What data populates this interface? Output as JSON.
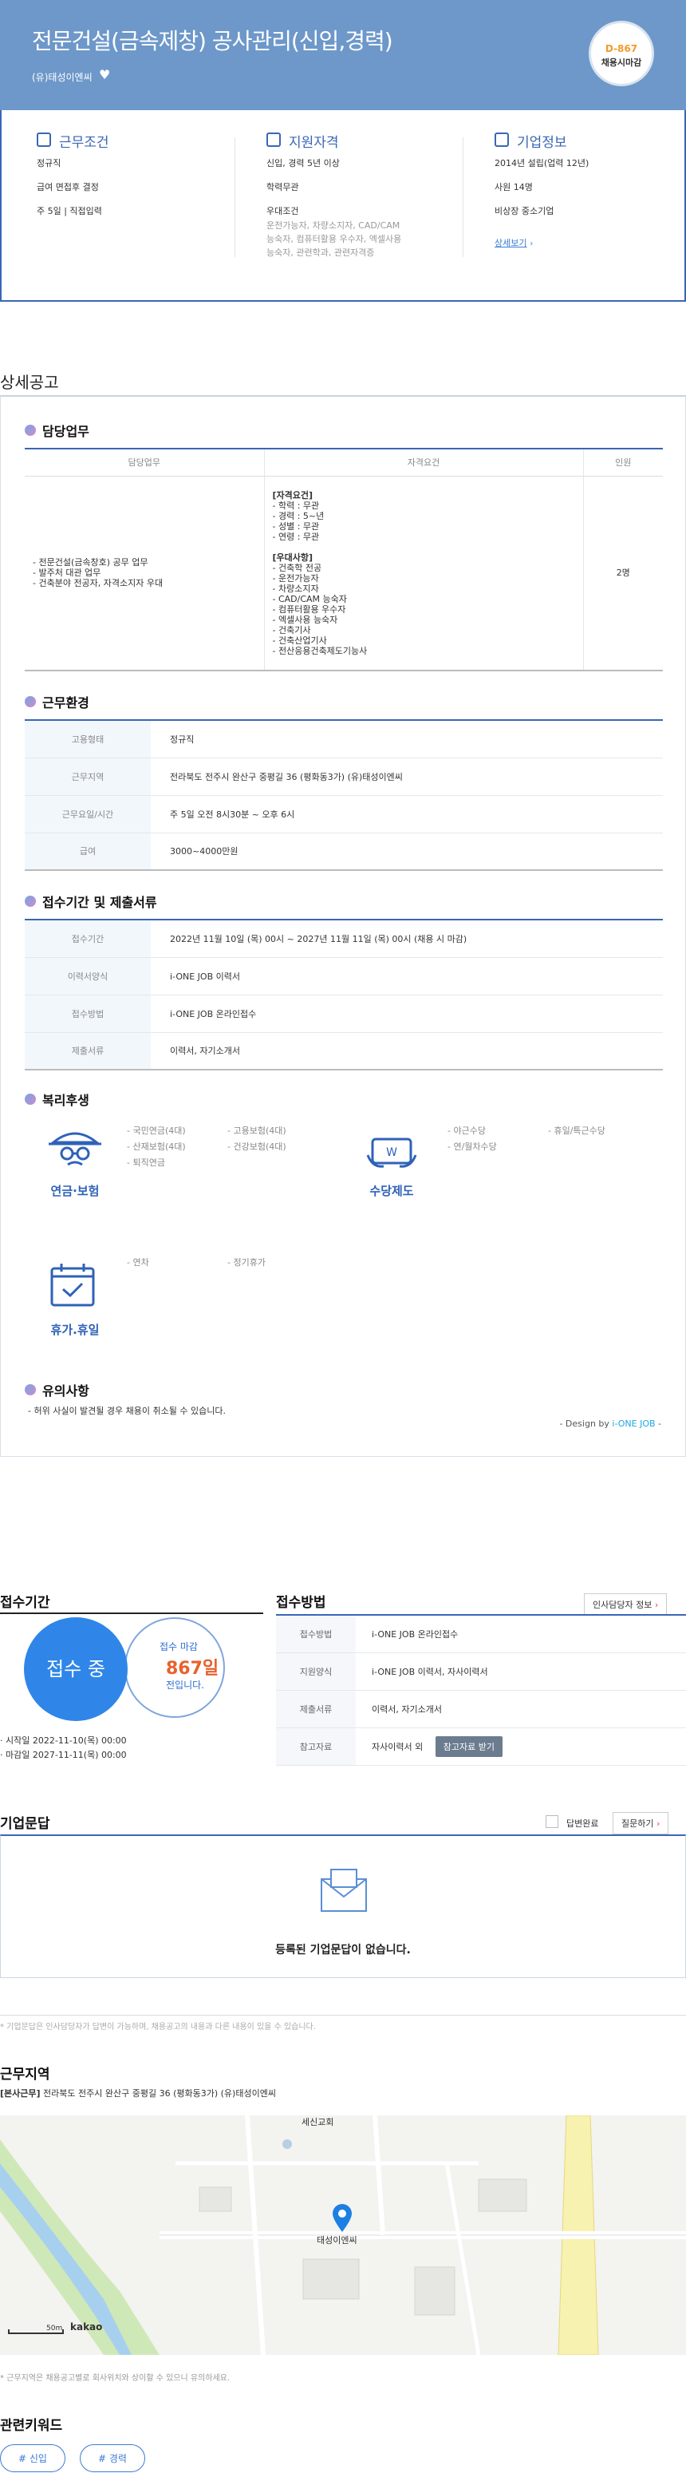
{
  "header": {
    "title": "전문건설(금속제창) 공사관리(신입,경력)",
    "company": "(유)태성이엔씨",
    "dday": "D-867",
    "dday_label": "채용시마감",
    "bg_color": "#6d98c9"
  },
  "summary": {
    "work": {
      "title": "근무조건",
      "lines": [
        "정규직",
        "급여 면접후 결정",
        "주 5일 | 직접입력"
      ]
    },
    "qual": {
      "title": "지원자격",
      "lines": [
        "신입, 경력 5년 이상",
        "학력무관",
        "우대조건"
      ],
      "sub": [
        "운전가능자, 차량소지자, CAD/CAM",
        "능숙자, 컴퓨터활용 우수자, 엑셀사용",
        "능숙자, 관련학과, 관련자격증"
      ]
    },
    "corp": {
      "title": "기업정보",
      "lines": [
        "2014년 설립(업력 12년)",
        "사원 14명",
        "비상장 중소기업"
      ],
      "more": "상세보기"
    }
  },
  "detail": {
    "heading": "상세공고",
    "duty": {
      "title": "담당업무",
      "headers": [
        "담당업무",
        "자격요건",
        "인원"
      ],
      "tasks": [
        "- 전문건설(금속창호) 공무 업무",
        "- 발주처 대관 업무",
        "- 건축분야 전공자, 자격소지자 우대"
      ],
      "req_title": "[자격요건]",
      "req": [
        "- 학력 : 무관",
        "- 경력 : 5~년",
        "- 성별 : 무관",
        "- 연령 : 무관"
      ],
      "pref_title": "[우대사항]",
      "pref": [
        "- 건축학 전공",
        "- 운전가능자",
        "- 차량소지자",
        "- CAD/CAM 능숙자",
        "- 컴퓨터활용 우수자",
        "- 엑셀사용 능숙자",
        "- 건축기사",
        "- 건축산업기사",
        "- 전산응용건축제도기능사"
      ],
      "count": "2명"
    },
    "env": {
      "title": "근무환경",
      "rows": [
        [
          "고용형태",
          "정규직"
        ],
        [
          "근무지역",
          "전라북도 전주시 완산구 중평길 36 (평화동3가) (유)태성이엔씨"
        ],
        [
          "근무요일/시간",
          "주 5일 오전 8시30분 ~ 오후 6시"
        ],
        [
          "급여",
          "3000~4000만원"
        ]
      ]
    },
    "apply": {
      "title": "접수기간 및 제출서류",
      "rows": [
        [
          "접수기간",
          "2022년 11월 10일 (목) 00시 ~ 2027년 11월 11일 (목) 00시 (채용 시 마감)"
        ],
        [
          "이력서양식",
          "i-ONE JOB 이력서"
        ],
        [
          "접수방법",
          "i-ONE JOB 온라인접수"
        ],
        [
          "제출서류",
          "이력서, 자기소개서"
        ]
      ]
    },
    "welfare": {
      "title": "복리후생",
      "pension": {
        "label": "연금·보험",
        "items": [
          "- 국민연금(4대)",
          "- 산재보험(4대)",
          "- 퇴직연금",
          "- 고용보험(4대)",
          "- 건강보험(4대)"
        ]
      },
      "allowance": {
        "label": "수당제도",
        "items": [
          "- 야근수당",
          "- 연/월차수당",
          "- 휴일/특근수당"
        ]
      },
      "vacation": {
        "label": "휴가.휴일",
        "items": [
          "- 연차",
          "- 정기휴가"
        ]
      }
    },
    "notes": {
      "title": "유의사항",
      "text": "- 허위 사실이 발견될 경우 채용이 취소될 수 있습니다."
    },
    "design_prefix": "- Design by ",
    "design_brand": "i-ONE JOB",
    "design_suffix": " -"
  },
  "period": {
    "title": "접수기간",
    "status": "접수 중",
    "deadline_label": "접수 마감",
    "days": "867일",
    "remain": "전입니다.",
    "start": "시작일 2022-11-10(목) 00:00",
    "end": "마감일 2027-11-11(목) 00:00"
  },
  "method": {
    "title": "접수방법",
    "hr_button": "인사담당자 정보",
    "rows": [
      [
        "접수방법",
        "i-ONE JOB 온라인접수"
      ],
      [
        "지원양식",
        "i-ONE JOB 이력서, 자사이력서"
      ],
      [
        "제출서류",
        "이력서, 자기소개서"
      ],
      [
        "참고자료",
        "자사이력서 외"
      ]
    ],
    "ref_button": "참고자료 받기"
  },
  "qa": {
    "title": "기업문답",
    "checkbox": "답변완료",
    "ask_button": "질문하기",
    "empty": "등록된 기업문답이 없습니다.",
    "note": "* 기업문답은 인사담당자가 답변이 가능하며, 채용공고의 내용과 다른 내용이 있을 수 있습니다."
  },
  "location": {
    "title": "근무지역",
    "tag": "[본사근무]",
    "address": "전라북도 전주시 완산구 중평길 36 (평화동3가) (유)태성이엔씨",
    "map_label1": "세신교회",
    "map_label2": "태성이엔씨",
    "scale": "50m",
    "brand": "kakao",
    "note": "* 근무지역은 채용공고별로 회사위치와 상이할 수 있으니 유의하세요."
  },
  "keywords": {
    "title": "관련키워드",
    "items": [
      "# 신입",
      "# 경력"
    ]
  }
}
